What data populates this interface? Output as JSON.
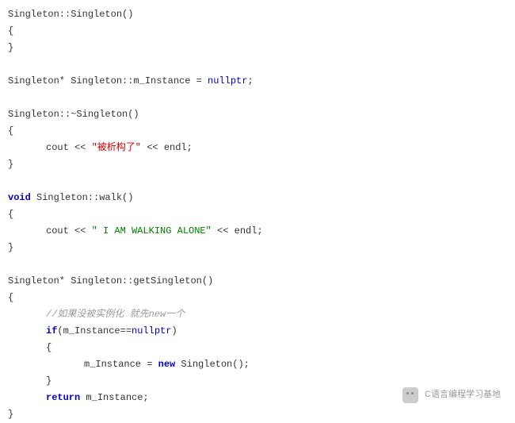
{
  "code": {
    "line1": "Singleton::Singleton()",
    "line2": "{",
    "line3": "}",
    "line4_a": "Singleton* Singleton::m_Instance = ",
    "line4_b": "nullptr",
    "line4_c": ";",
    "line5": "Singleton::~Singleton()",
    "line6": "{",
    "line7_a": "cout << ",
    "line7_b": "\"被析构了\"",
    "line7_c": " << endl;",
    "line8": "}",
    "line9_a": "void",
    "line9_b": " Singleton::walk()",
    "line10": "{",
    "line11_a": "cout << ",
    "line11_b": "\" I AM WALKING ALONE\"",
    "line11_c": " << endl;",
    "line12": "}",
    "line13": "Singleton* Singleton::getSingleton()",
    "line14": "{",
    "line15": "//如果没被实例化 就先new一个",
    "line16_a": "if",
    "line16_b": "(m_Instance==",
    "line16_c": "nullptr",
    "line16_d": ")",
    "line17": "{",
    "line18_a": "m_Instance = ",
    "line18_b": "new",
    "line18_c": " Singleton();",
    "line19": "}",
    "line20_a": "return",
    "line20_b": " m_Instance;",
    "line21": "}"
  },
  "watermark": "C语言编程学习基地"
}
